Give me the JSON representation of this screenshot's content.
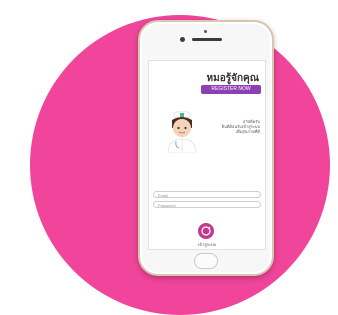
{
  "colors": {
    "background_circle": "#f0459a",
    "accent_purple": "#8e3fb4",
    "login_magenta": "#c23a8d"
  },
  "app": {
    "title": "หมอรู้จักคุณ",
    "register_label": "REGISTER NOW",
    "greeting_lines": [
      "สวัสดีครับ",
      "ยินดีต้อนรับเข้าสู่ระบบ",
      "เพื่อสุขภาพที่ดี"
    ]
  },
  "login": {
    "username_placeholder": "Email",
    "password_placeholder": "Password",
    "button_label": "เข้าสู่ระบบ"
  }
}
